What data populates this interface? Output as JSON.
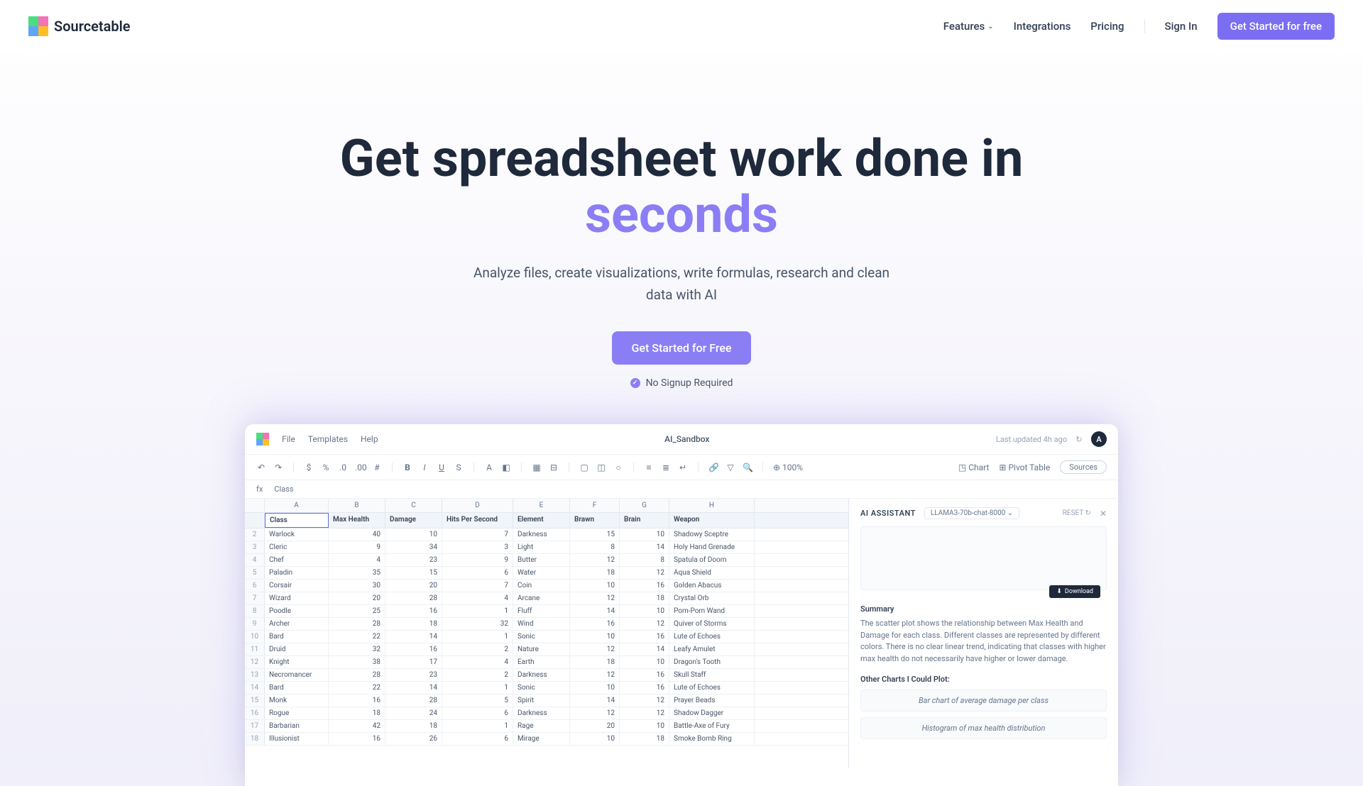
{
  "brand": "Sourcetable",
  "nav": {
    "features": "Features",
    "integrations": "Integrations",
    "pricing": "Pricing",
    "signin": "Sign In",
    "cta": "Get Started for free"
  },
  "hero": {
    "title_pre": "Get spreadsheet work done in ",
    "title_accent": "seconds",
    "subtitle": "Analyze files, create visualizations, write formulas, research and clean data with AI",
    "cta": "Get Started for Free",
    "note": "No Signup Required"
  },
  "app": {
    "menu": [
      "File",
      "Templates",
      "Help"
    ],
    "title": "AI_Sandbox",
    "last_updated": "Last updated 4h ago",
    "avatar": "A",
    "toolbar_right": {
      "chart": "Chart",
      "pivot": "Pivot Table",
      "sources": "Sources"
    },
    "zoom": "100%",
    "formula_cell": "Class",
    "col_letters": [
      "",
      "A",
      "B",
      "C",
      "D",
      "E",
      "F",
      "G",
      "H"
    ],
    "headers": [
      "",
      "Class",
      "Max Health",
      "Damage",
      "Hits Per Second",
      "Element",
      "Brawn",
      "Brain",
      "Weapon"
    ],
    "rows": [
      {
        "n": 2,
        "d": [
          "Warlock",
          "40",
          "10",
          "7",
          "Darkness",
          "15",
          "10",
          "Shadowy Sceptre"
        ]
      },
      {
        "n": 3,
        "d": [
          "Cleric",
          "9",
          "34",
          "3",
          "Light",
          "8",
          "14",
          "Holy Hand Grenade"
        ]
      },
      {
        "n": 4,
        "d": [
          "Chef",
          "4",
          "23",
          "9",
          "Butter",
          "12",
          "8",
          "Spatula of Doom"
        ]
      },
      {
        "n": 5,
        "d": [
          "Paladin",
          "35",
          "15",
          "6",
          "Water",
          "18",
          "12",
          "Aqua Shield"
        ]
      },
      {
        "n": 6,
        "d": [
          "Corsair",
          "30",
          "20",
          "7",
          "Coin",
          "10",
          "16",
          "Golden Abacus"
        ]
      },
      {
        "n": 7,
        "d": [
          "Wizard",
          "20",
          "28",
          "4",
          "Arcane",
          "12",
          "18",
          "Crystal Orb"
        ]
      },
      {
        "n": 8,
        "d": [
          "Poodle",
          "25",
          "16",
          "1",
          "Fluff",
          "14",
          "10",
          "Pom-Pom Wand"
        ]
      },
      {
        "n": 9,
        "d": [
          "Archer",
          "28",
          "18",
          "32",
          "Wind",
          "16",
          "12",
          "Quiver of Storms"
        ]
      },
      {
        "n": 10,
        "d": [
          "Bard",
          "22",
          "14",
          "1",
          "Sonic",
          "10",
          "16",
          "Lute of Echoes"
        ]
      },
      {
        "n": 11,
        "d": [
          "Druid",
          "32",
          "16",
          "2",
          "Nature",
          "12",
          "14",
          "Leafy Amulet"
        ]
      },
      {
        "n": 12,
        "d": [
          "Knight",
          "38",
          "17",
          "4",
          "Earth",
          "18",
          "10",
          "Dragon's Tooth"
        ]
      },
      {
        "n": 13,
        "d": [
          "Necromancer",
          "28",
          "23",
          "2",
          "Darkness",
          "12",
          "16",
          "Skull Staff"
        ]
      },
      {
        "n": 14,
        "d": [
          "Bard",
          "22",
          "14",
          "1",
          "Sonic",
          "10",
          "16",
          "Lute of Echoes"
        ]
      },
      {
        "n": 15,
        "d": [
          "Monk",
          "16",
          "28",
          "5",
          "Spirit",
          "14",
          "12",
          "Prayer Beads"
        ]
      },
      {
        "n": 16,
        "d": [
          "Rogue",
          "18",
          "24",
          "6",
          "Darkness",
          "12",
          "12",
          "Shadow Dagger"
        ]
      },
      {
        "n": 17,
        "d": [
          "Barbarian",
          "42",
          "18",
          "1",
          "Rage",
          "20",
          "10",
          "Battle-Axe of Fury"
        ]
      },
      {
        "n": 18,
        "d": [
          "Illusionist",
          "16",
          "26",
          "6",
          "Mirage",
          "10",
          "18",
          "Smoke Bomb Ring"
        ]
      }
    ]
  },
  "ai": {
    "title": "AI ASSISTANT",
    "model": "LLAMA3-70b-chat-8000",
    "reset": "RESET",
    "download": "Download",
    "summary_title": "Summary",
    "summary": "The scatter plot shows the relationship between Max Health and Damage for each class. Different classes are represented by different colors. There is no clear linear trend, indicating that classes with higher max health do not necessarily have higher or lower damage.",
    "other_title": "Other Charts I Could Plot:",
    "suggestions": [
      "Bar chart of average damage per class",
      "Histogram of max health distribution"
    ]
  }
}
